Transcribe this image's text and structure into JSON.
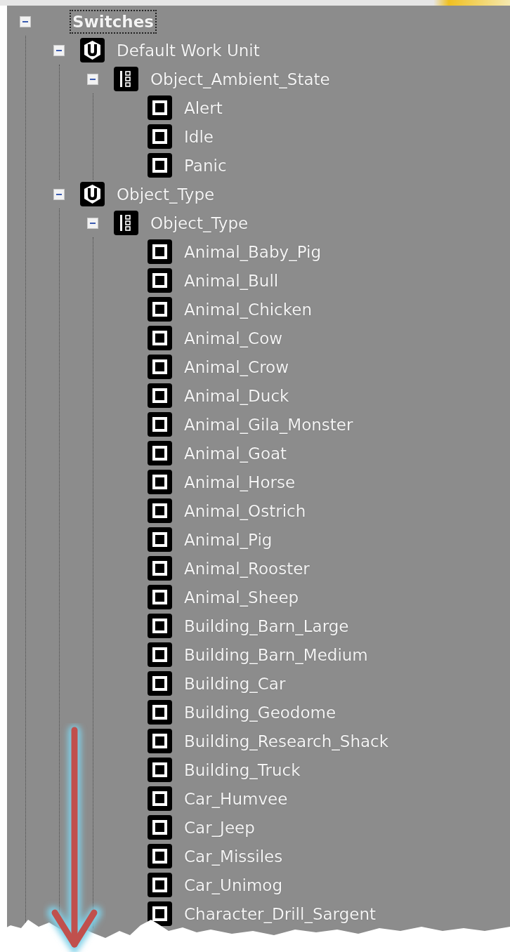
{
  "tree": [
    {
      "label": "Switches",
      "kind": "folder",
      "selected": true,
      "expanded": true,
      "children": [
        {
          "label": "Default Work Unit",
          "kind": "work_unit",
          "selected": false,
          "expanded": true,
          "children": [
            {
              "label": "Object_Ambient_State",
              "kind": "switch_group",
              "selected": false,
              "expanded": true,
              "children": [
                {
                  "label": "Alert",
                  "kind": "switch",
                  "selected": false
                },
                {
                  "label": "Idle",
                  "kind": "switch",
                  "selected": false
                },
                {
                  "label": "Panic",
                  "kind": "switch",
                  "selected": false
                }
              ]
            }
          ]
        },
        {
          "label": "Object_Type",
          "kind": "work_unit",
          "selected": false,
          "expanded": true,
          "children": [
            {
              "label": "Object_Type",
              "kind": "switch_group",
              "selected": false,
              "expanded": true,
              "children": [
                {
                  "label": "Animal_Baby_Pig",
                  "kind": "switch",
                  "selected": false
                },
                {
                  "label": "Animal_Bull",
                  "kind": "switch",
                  "selected": false
                },
                {
                  "label": "Animal_Chicken",
                  "kind": "switch",
                  "selected": false
                },
                {
                  "label": "Animal_Cow",
                  "kind": "switch",
                  "selected": false
                },
                {
                  "label": "Animal_Crow",
                  "kind": "switch",
                  "selected": false
                },
                {
                  "label": "Animal_Duck",
                  "kind": "switch",
                  "selected": false
                },
                {
                  "label": "Animal_Gila_Monster",
                  "kind": "switch",
                  "selected": false
                },
                {
                  "label": "Animal_Goat",
                  "kind": "switch",
                  "selected": false
                },
                {
                  "label": "Animal_Horse",
                  "kind": "switch",
                  "selected": false
                },
                {
                  "label": "Animal_Ostrich",
                  "kind": "switch",
                  "selected": false
                },
                {
                  "label": "Animal_Pig",
                  "kind": "switch",
                  "selected": false
                },
                {
                  "label": "Animal_Rooster",
                  "kind": "switch",
                  "selected": false
                },
                {
                  "label": "Animal_Sheep",
                  "kind": "switch",
                  "selected": false
                },
                {
                  "label": "Building_Barn_Large",
                  "kind": "switch",
                  "selected": false
                },
                {
                  "label": "Building_Barn_Medium",
                  "kind": "switch",
                  "selected": false
                },
                {
                  "label": "Building_Car",
                  "kind": "switch",
                  "selected": false
                },
                {
                  "label": "Building_Geodome",
                  "kind": "switch",
                  "selected": false
                },
                {
                  "label": "Building_Research_Shack",
                  "kind": "switch",
                  "selected": false
                },
                {
                  "label": "Building_Truck",
                  "kind": "switch",
                  "selected": false
                },
                {
                  "label": "Car_Humvee",
                  "kind": "switch",
                  "selected": false
                },
                {
                  "label": "Car_Jeep",
                  "kind": "switch",
                  "selected": false
                },
                {
                  "label": "Car_Missiles",
                  "kind": "switch",
                  "selected": false
                },
                {
                  "label": "Car_Unimog",
                  "kind": "switch",
                  "selected": false
                },
                {
                  "label": "Character_Drill_Sargent",
                  "kind": "switch",
                  "selected": false
                }
              ]
            }
          ]
        }
      ]
    }
  ]
}
